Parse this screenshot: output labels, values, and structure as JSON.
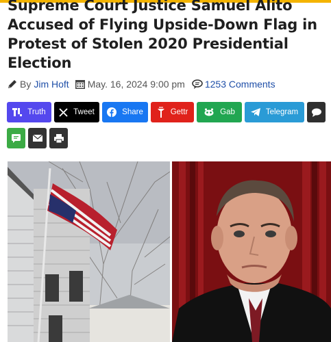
{
  "article": {
    "headline_lines": [
      "Supreme Court Justice Samuel Alito",
      "Accused of Flying Upside-Down Flag in",
      "Protest of Stolen 2020 Presidential",
      "Election"
    ],
    "by_label": "By",
    "author": "Jim Hoft",
    "date": "May. 16, 2024 9:00 pm",
    "comments": "1253 Comments"
  },
  "share": {
    "truth": "Truth",
    "tweet": "Tweet",
    "share": "Share",
    "gettr": "Gettr",
    "gab": "Gab",
    "telegram": "Telegram"
  },
  "colors": {
    "accent_bar": "#f4b400",
    "link": "#1f4fa8",
    "truth": "#5448ee",
    "facebook": "#1877f2",
    "gettr": "#e0221b",
    "gab": "#21a651",
    "telegram": "#2a9bd6"
  },
  "icons": [
    "pencil-icon",
    "calendar-icon",
    "comment-bubble-icon",
    "truth-social-icon",
    "x-icon",
    "facebook-icon",
    "gettr-icon",
    "gab-icon",
    "telegram-icon",
    "comment-icon",
    "sms-icon",
    "email-icon",
    "print-icon"
  ]
}
